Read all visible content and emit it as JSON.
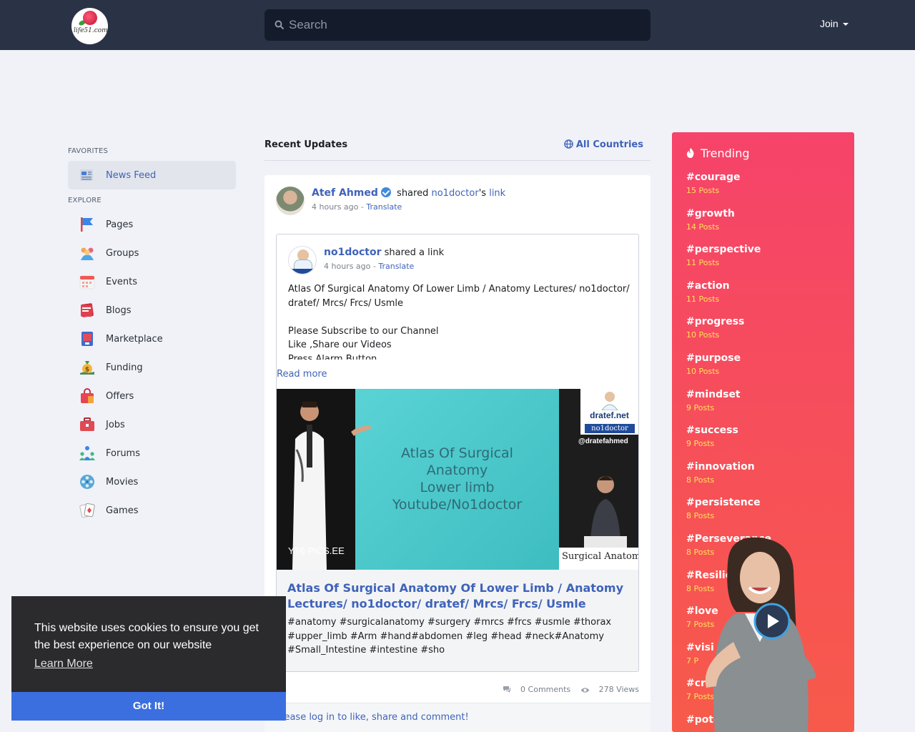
{
  "header": {
    "logo_text": "life51.com",
    "search_placeholder": "Search",
    "join_label": "Join"
  },
  "sidebar": {
    "favorites_label": "FAVORITES",
    "favorites": [
      {
        "label": "News Feed",
        "icon": "newspaper-icon",
        "active": true
      }
    ],
    "explore_label": "EXPLORE",
    "explore": [
      {
        "label": "Pages",
        "icon": "flag-icon"
      },
      {
        "label": "Groups",
        "icon": "people-icon"
      },
      {
        "label": "Events",
        "icon": "calendar-icon"
      },
      {
        "label": "Blogs",
        "icon": "book-icon"
      },
      {
        "label": "Marketplace",
        "icon": "store-icon"
      },
      {
        "label": "Funding",
        "icon": "money-bag-icon"
      },
      {
        "label": "Offers",
        "icon": "shopping-bag-icon"
      },
      {
        "label": "Jobs",
        "icon": "briefcase-icon"
      },
      {
        "label": "Forums",
        "icon": "forum-icon"
      },
      {
        "label": "Movies",
        "icon": "film-reel-icon"
      },
      {
        "label": "Games",
        "icon": "playing-cards-icon"
      }
    ]
  },
  "feed": {
    "title": "Recent Updates",
    "countries_label": "All Countries",
    "post": {
      "author": "Atef Ahmed",
      "action": "shared",
      "target_name": "no1doctor",
      "possessive": "'s",
      "target_type": "link",
      "time": "4 hours ago",
      "separator": "-",
      "translate": "Translate",
      "shared": {
        "author": "no1doctor",
        "action": "shared a link",
        "time": "4 hours ago",
        "separator": "-",
        "translate": "Translate",
        "body_line1": "Atlas Of Surgical Anatomy Of Lower Limb / Anatomy Lectures/ no1doctor/ dratef/ Mrcs/ Frcs/ Usmle",
        "body_line2": "Please Subscribe to our Channel",
        "body_line3": "Like ,Share our Videos",
        "body_line4": "Press Alarm Button",
        "read_more": "Read more",
        "video": {
          "slide_line1": "Atlas Of Surgical",
          "slide_line2": "Anatomy",
          "slide_line3": "Lower limb",
          "slide_line4": "Youtube/No1doctor",
          "brand_site": "dratef.net",
          "brand_name": "no1doctor",
          "handle": "@dratefahmed",
          "strip_text": "Surgical Anatomy",
          "watermark": "YT6.PICS.EE"
        },
        "link_title": "Atlas Of Surgical Anatomy Of Lower Limb / Anatomy Lectures/ no1doctor/ dratef/ Mrcs/ Frcs/ Usmle",
        "link_tags": "#anatomy #surgicalanatomy #surgery #mrcs #frcs #usmle #thorax #upper_limb #Arm #hand#abdomen #leg #head #neck#Anatomy #Small_Intestine #intestine #sho"
      },
      "comments": "0 Comments",
      "views": "278 Views",
      "login_prompt": "Please log in to like, share and comment!"
    }
  },
  "trending": {
    "title": "Trending",
    "items": [
      {
        "tag": "#courage",
        "count": "15 Posts"
      },
      {
        "tag": "#growth",
        "count": "14 Posts"
      },
      {
        "tag": "#perspective",
        "count": "11 Posts"
      },
      {
        "tag": "#action",
        "count": "11 Posts"
      },
      {
        "tag": "#progress",
        "count": "10 Posts"
      },
      {
        "tag": "#purpose",
        "count": "10 Posts"
      },
      {
        "tag": "#mindset",
        "count": "9 Posts"
      },
      {
        "tag": "#success",
        "count": "9 Posts"
      },
      {
        "tag": "#innovation",
        "count": "8 Posts"
      },
      {
        "tag": "#persistence",
        "count": "8 Posts"
      },
      {
        "tag": "#Perseverance",
        "count": "8 Posts"
      },
      {
        "tag": "#Resilience",
        "count": "8 Posts"
      },
      {
        "tag": "#love",
        "count": "7 Posts"
      },
      {
        "tag": "#visi",
        "count": "7 P"
      },
      {
        "tag": "#creativ",
        "count": "7 Posts"
      },
      {
        "tag": "#poten",
        "count": ""
      }
    ]
  },
  "cookie": {
    "message": "This website uses cookies to ensure you get the best experience on our website",
    "learn_more": "Learn More",
    "accept": "Got It!"
  },
  "colors": {
    "header_bg": "#2a3346",
    "accent": "#3f63b9",
    "trending_bg": "#f6436a",
    "trending_count": "#ffe15a",
    "cookie_button": "#3b6fe0"
  }
}
